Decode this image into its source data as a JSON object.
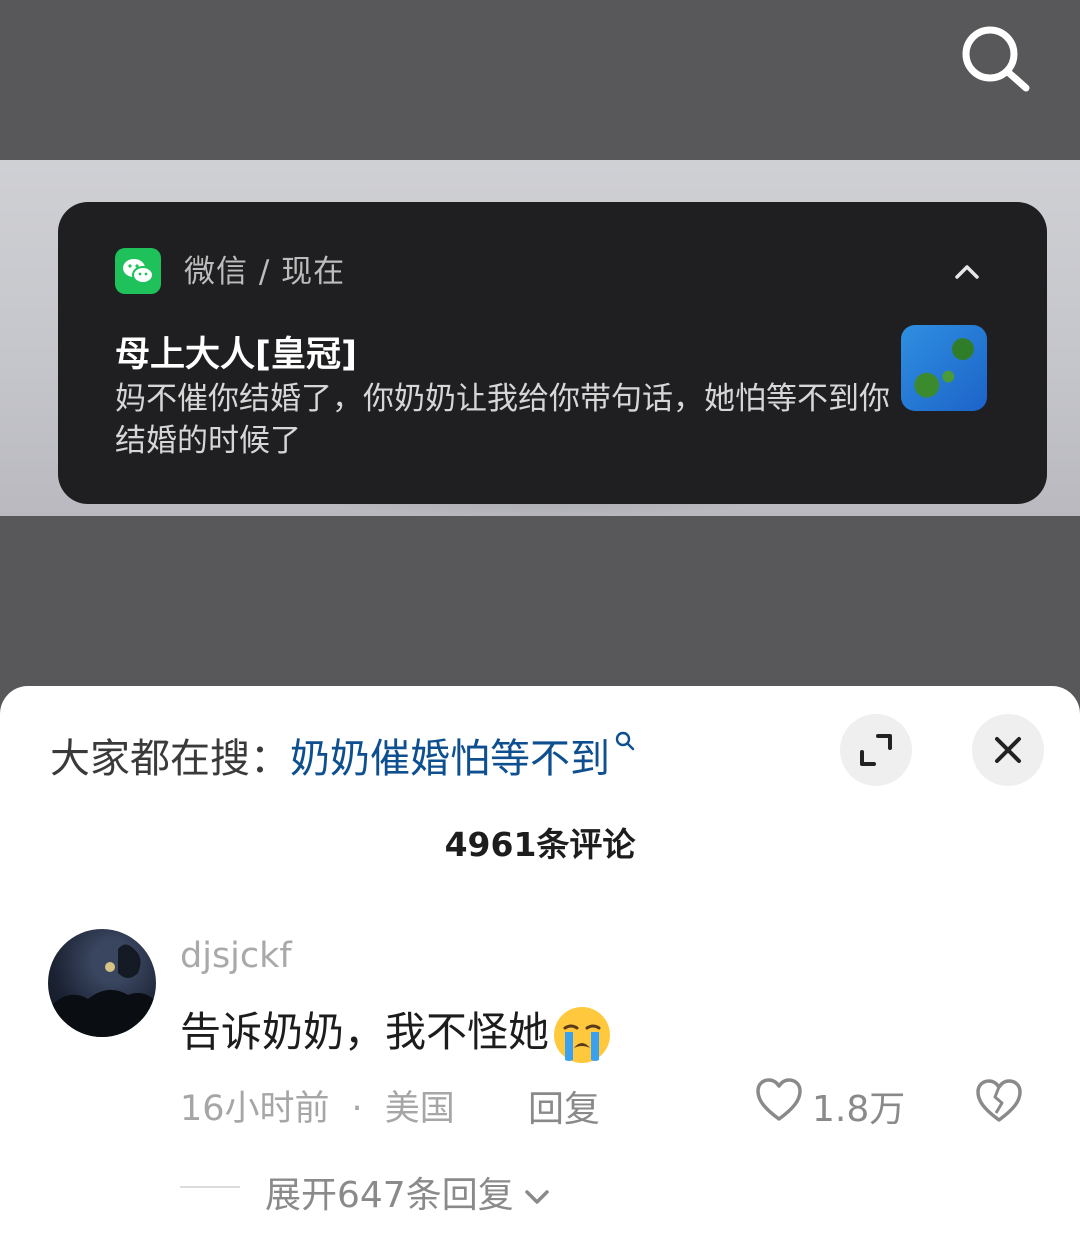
{
  "colors": {
    "sheet_bg": "#ffffff",
    "link_blue": "#0e4f8f",
    "wechat_green": "#1fc15a",
    "notif_bg": "#1f1f21"
  },
  "icons": [
    "search-icon",
    "wechat-icon",
    "chevron-up-icon",
    "expand-icon",
    "close-icon",
    "search-small-icon",
    "crying-emoji",
    "heart-icon",
    "broken-heart-icon",
    "chevron-down-icon"
  ],
  "notification": {
    "app": "微信 / 现在",
    "sender": "母上大人[皇冠]",
    "message": "妈不催你结婚了，你奶奶让我给你带句话，她怕等不到你结婚的时候了"
  },
  "comments_panel": {
    "hot_search_label": "大家都在搜：",
    "hot_search_term": "奶奶催婚怕等不到",
    "comment_count": "4961条评论",
    "comment": {
      "username": "djsjckf",
      "text": "告诉奶奶，我不怪她",
      "time": "16小时前",
      "location": "美国",
      "reply_label": "回复",
      "likes": "1.8万",
      "expand_replies": "展开647条回复"
    }
  }
}
